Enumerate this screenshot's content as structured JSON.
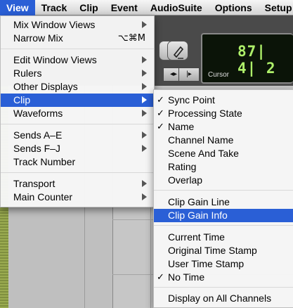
{
  "menubar": {
    "items": [
      "View",
      "Track",
      "Clip",
      "Event",
      "AudioSuite",
      "Options",
      "Setup"
    ],
    "active": "View"
  },
  "counter": {
    "value": "87| 4| 2",
    "label": "Cursor"
  },
  "view_menu": {
    "mix_window_views": "Mix Window Views",
    "narrow_mix": "Narrow Mix",
    "narrow_mix_shortcut": "⌥⌘M",
    "edit_window_views": "Edit Window Views",
    "rulers": "Rulers",
    "other_displays": "Other Displays",
    "clip": "Clip",
    "waveforms": "Waveforms",
    "sends_a_e": "Sends A–E",
    "sends_f_j": "Sends F–J",
    "track_number": "Track Number",
    "transport": "Transport",
    "main_counter": "Main Counter"
  },
  "clip_menu": {
    "sync_point": "Sync Point",
    "processing_state": "Processing State",
    "name": "Name",
    "channel_name": "Channel Name",
    "scene_and_take": "Scene And Take",
    "rating": "Rating",
    "overlap": "Overlap",
    "clip_gain_line": "Clip Gain Line",
    "clip_gain_info": "Clip Gain Info",
    "current_time": "Current Time",
    "original_time_stamp": "Original Time Stamp",
    "user_time_stamp": "User Time Stamp",
    "no_time": "No Time",
    "display_on_all_channels": "Display on All Channels",
    "checkmark": "✓"
  },
  "colors": {
    "highlight": "#2a5fd6",
    "counter_text": "#aef06a"
  }
}
